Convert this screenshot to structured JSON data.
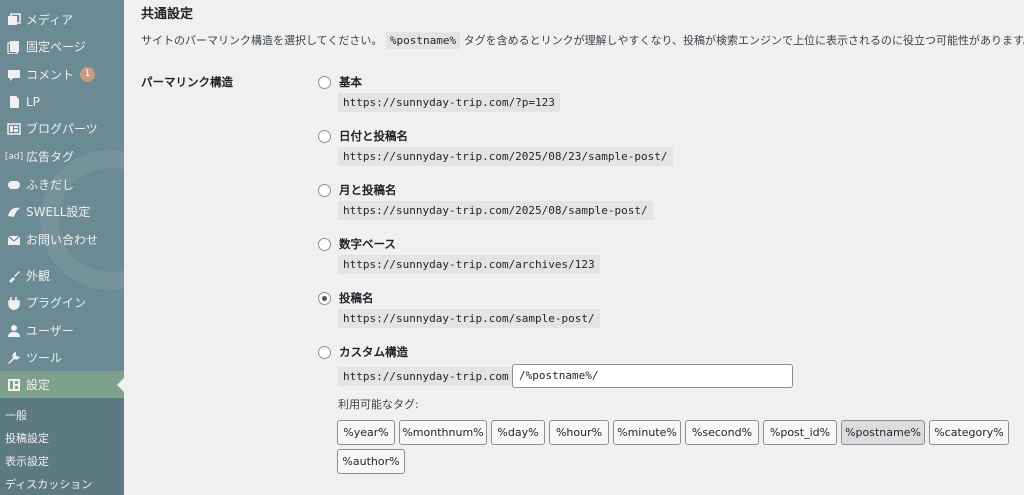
{
  "sidebar": {
    "items": [
      {
        "label": "メディア",
        "icon": "media-icon"
      },
      {
        "label": "固定ページ",
        "icon": "pages-icon"
      },
      {
        "label": "コメント",
        "icon": "comments-icon",
        "badge": "1"
      },
      {
        "label": "LP",
        "icon": "lp-icon"
      },
      {
        "label": "ブログパーツ",
        "icon": "blog-parts-icon"
      },
      {
        "label": "広告タグ",
        "icon": "ad-tag-icon"
      },
      {
        "label": "ふきだし",
        "icon": "balloon-icon"
      },
      {
        "label": "SWELL設定",
        "icon": "swell-icon"
      },
      {
        "label": "お問い合わせ",
        "icon": "mail-icon"
      },
      {
        "label": "外観",
        "icon": "appearance-icon"
      },
      {
        "label": "プラグイン",
        "icon": "plugins-icon"
      },
      {
        "label": "ユーザー",
        "icon": "users-icon"
      },
      {
        "label": "ツール",
        "icon": "tools-icon"
      },
      {
        "label": "設定",
        "icon": "settings-icon",
        "active": true
      }
    ],
    "submenu": [
      "一般",
      "投稿設定",
      "表示設定",
      "ディスカッション"
    ]
  },
  "main": {
    "section_title": "共通設定",
    "desc_before": "サイトのパーマリンク構造を選択してください。",
    "desc_code": "%postname%",
    "desc_after": "タグを含めるとリンクが理解しやすくなり、投稿が検索エンジンで上位に表示されるのに役立つ可能性があります。",
    "field_label": "パーマリンク構造",
    "options": [
      {
        "label": "基本",
        "url": "https://sunnyday-trip.com/?p=123",
        "checked": false
      },
      {
        "label": "日付と投稿名",
        "url": "https://sunnyday-trip.com/2025/08/23/sample-post/",
        "checked": false
      },
      {
        "label": "月と投稿名",
        "url": "https://sunnyday-trip.com/2025/08/sample-post/",
        "checked": false
      },
      {
        "label": "数字ベース",
        "url": "https://sunnyday-trip.com/archives/123",
        "checked": false
      },
      {
        "label": "投稿名",
        "url": "https://sunnyday-trip.com/sample-post/",
        "checked": true
      },
      {
        "label": "カスタム構造",
        "url": "https://sunnyday-trip.com",
        "checked": false
      }
    ],
    "custom_value": "/%postname%/",
    "tags_label": "利用可能なタグ:",
    "tags": [
      "%year%",
      "%monthnum%",
      "%day%",
      "%hour%",
      "%minute%",
      "%second%",
      "%post_id%",
      "%postname%",
      "%category%",
      "%author%"
    ],
    "active_tag": "%postname%"
  }
}
